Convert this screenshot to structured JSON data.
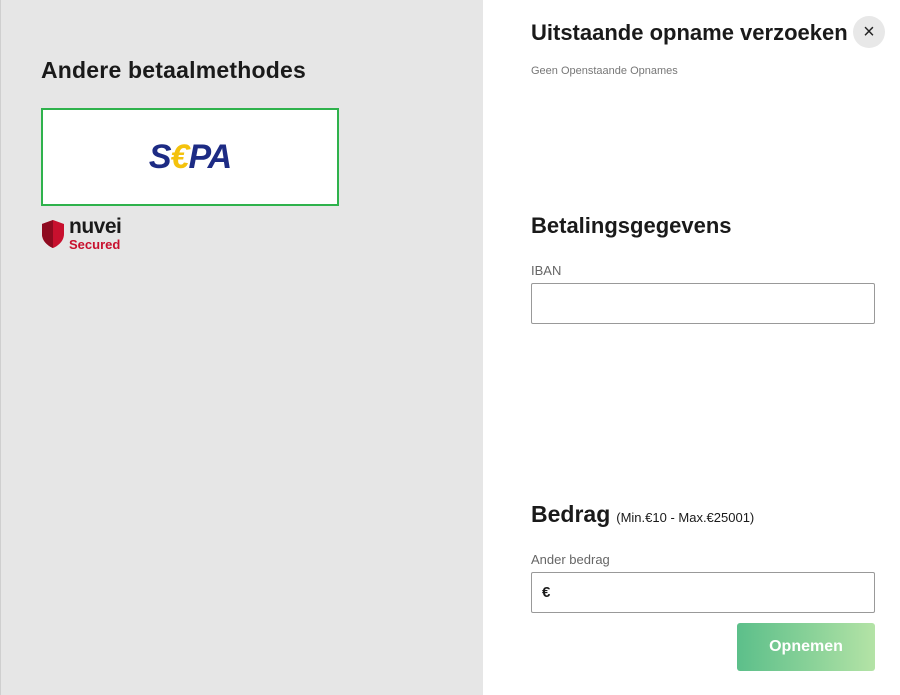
{
  "left": {
    "title": "Andere betaalmethodes",
    "methods": [
      {
        "name": "SEPA",
        "logo_parts": [
          "S",
          "€",
          "PA"
        ]
      }
    ],
    "badge": {
      "brand": "nuvei",
      "sub": "Secured"
    }
  },
  "right": {
    "pending_title": "Uitstaande opname verzoeken",
    "pending_empty": "Geen Openstaande Opnames",
    "close_icon": "×",
    "payment_title": "Betalingsgegevens",
    "iban_label": "IBAN",
    "iban_value": "",
    "amount_title": "Bedrag",
    "amount_range": "(Min.€10 - Max.€25001)",
    "amount_label": "Ander bedrag",
    "currency_symbol": "€",
    "amount_value": "",
    "submit_label": "Opnemen"
  },
  "colors": {
    "left_bg": "#e6e6e6",
    "sepa_border": "#2fb24c",
    "sepa_blue": "#1d2b84",
    "sepa_gold": "#f4c20d",
    "nuvei_red": "#c8102e",
    "submit_gradient_start": "#5cbf8a",
    "submit_gradient_end": "#b4e3a6"
  }
}
